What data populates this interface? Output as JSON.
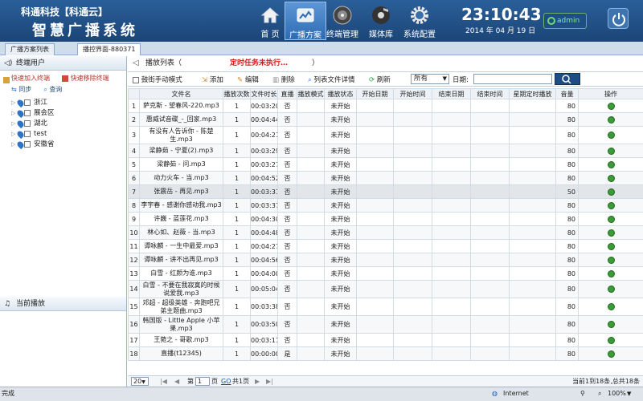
{
  "header": {
    "brand_top": "科通科技【科通云】",
    "brand_main": "智慧广播系统",
    "time": "23:10:43",
    "date": "2014 年 04 月 19 日",
    "user": "admin"
  },
  "nav": [
    {
      "label": "首 页",
      "icon": "home-icon"
    },
    {
      "label": "广播方案",
      "icon": "broadcast-plan-icon"
    },
    {
      "label": "终端管理",
      "icon": "speaker-icon"
    },
    {
      "label": "媒体库",
      "icon": "media-library-icon"
    },
    {
      "label": "系统配置",
      "icon": "gear-icon"
    }
  ],
  "tabs": [
    "广播方案列表",
    "播控界面-880371"
  ],
  "left": {
    "terminal_title": "终端用户",
    "quick_add": "快速加入终端",
    "quick_remove": "快速移除终端",
    "sync": "同步",
    "query": "查询",
    "tree": [
      "浙江",
      "展会区",
      "湖北",
      "test",
      "安徽省"
    ],
    "current_title": "当前播放"
  },
  "playlist": {
    "title": "播放列表（",
    "status": "定时任务未执行…",
    "close": "）"
  },
  "toolbar": {
    "manual": "鼓街手动模式",
    "add": "添加",
    "edit": "编辑",
    "delete": "删除",
    "details": "列表文件详情",
    "refresh": "刷新",
    "filter": "所有",
    "date_label": "日期:"
  },
  "columns": [
    "",
    "文件名",
    "播放次数",
    "文件时长",
    "直播",
    "播放模式",
    "播放状态",
    "开始日期",
    "开始时间",
    "结束日期",
    "结束时间",
    "星期定时播放",
    "音量",
    "操作"
  ],
  "rows": [
    [
      "1",
      "萨克斯 - 望春风-220.mp3",
      "1",
      "00:03:20",
      "否",
      "",
      "未开始",
      "",
      "",
      "",
      "",
      "",
      "80"
    ],
    [
      "2",
      "惠威试音碟_-_回家.mp3",
      "1",
      "00:04:44",
      "否",
      "",
      "未开始",
      "",
      "",
      "",
      "",
      "",
      "80"
    ],
    [
      "3",
      "有没有人告诉你 - 陈楚生.mp3",
      "1",
      "00:04:21",
      "否",
      "",
      "未开始",
      "",
      "",
      "",
      "",
      "",
      "80"
    ],
    [
      "4",
      "梁静茹 - 宁夏(2).mp3",
      "1",
      "00:03:29",
      "否",
      "",
      "未开始",
      "",
      "",
      "",
      "",
      "",
      "80"
    ],
    [
      "5",
      "梁静茹 - 问.mp3",
      "1",
      "00:03:27",
      "否",
      "",
      "未开始",
      "",
      "",
      "",
      "",
      "",
      "80"
    ],
    [
      "6",
      "动力火车 - 当.mp3",
      "1",
      "00:04:52",
      "否",
      "",
      "未开始",
      "",
      "",
      "",
      "",
      "",
      "80"
    ],
    [
      "7",
      "张震岳 - 再见.mp3",
      "1",
      "00:03:31",
      "否",
      "",
      "未开始",
      "",
      "",
      "",
      "",
      "",
      "50"
    ],
    [
      "8",
      "李宇春 - 感谢你感动我.mp3",
      "1",
      "00:03:37",
      "否",
      "",
      "未开始",
      "",
      "",
      "",
      "",
      "",
      "80"
    ],
    [
      "9",
      "许巍 - 蓝莲花.mp3",
      "1",
      "00:04:30",
      "否",
      "",
      "未开始",
      "",
      "",
      "",
      "",
      "",
      "80"
    ],
    [
      "10",
      "林心如、赵薇 - 当.mp3",
      "1",
      "00:04:48",
      "否",
      "",
      "未开始",
      "",
      "",
      "",
      "",
      "",
      "80"
    ],
    [
      "11",
      "谭咏麟 - 一生中最爱.mp3",
      "1",
      "00:04:27",
      "否",
      "",
      "未开始",
      "",
      "",
      "",
      "",
      "",
      "80"
    ],
    [
      "12",
      "谭咏麟 - 讲不出再见.mp3",
      "1",
      "00:04:56",
      "否",
      "",
      "未开始",
      "",
      "",
      "",
      "",
      "",
      "80"
    ],
    [
      "13",
      "白雪 - 红颜为谁.mp3",
      "1",
      "00:04:00",
      "否",
      "",
      "未开始",
      "",
      "",
      "",
      "",
      "",
      "80"
    ],
    [
      "14",
      "白雪 - 不要在我寂寞的时候说爱我.mp3",
      "1",
      "00:05:04",
      "否",
      "",
      "未开始",
      "",
      "",
      "",
      "",
      "",
      "80"
    ],
    [
      "15",
      "邓超 - 超级英雄 - 奔跑吧兄弟主题曲.mp3",
      "1",
      "00:03:38",
      "否",
      "",
      "未开始",
      "",
      "",
      "",
      "",
      "",
      "80"
    ],
    [
      "16",
      "韩国版 - Little Apple 小苹果.mp3",
      "1",
      "00:03:50",
      "否",
      "",
      "未开始",
      "",
      "",
      "",
      "",
      "",
      "80"
    ],
    [
      "17",
      "王菀之 - 哥歌.mp3",
      "1",
      "00:03:11",
      "否",
      "",
      "未开始",
      "",
      "",
      "",
      "",
      "",
      "80"
    ],
    [
      "18",
      "直播(t12345)",
      "1",
      "00:00:00",
      "是",
      "",
      "未开始",
      "",
      "",
      "",
      "",
      "",
      "80"
    ]
  ],
  "pager": {
    "size": "20",
    "page_label": "第",
    "page": "1",
    "page_unit": "页",
    "go": "GO",
    "total_pages": "共1页",
    "summary": "当前1到18条,总共18条"
  },
  "statusbar": {
    "left": "完成",
    "internet": "Internet",
    "zoom": "100%"
  }
}
